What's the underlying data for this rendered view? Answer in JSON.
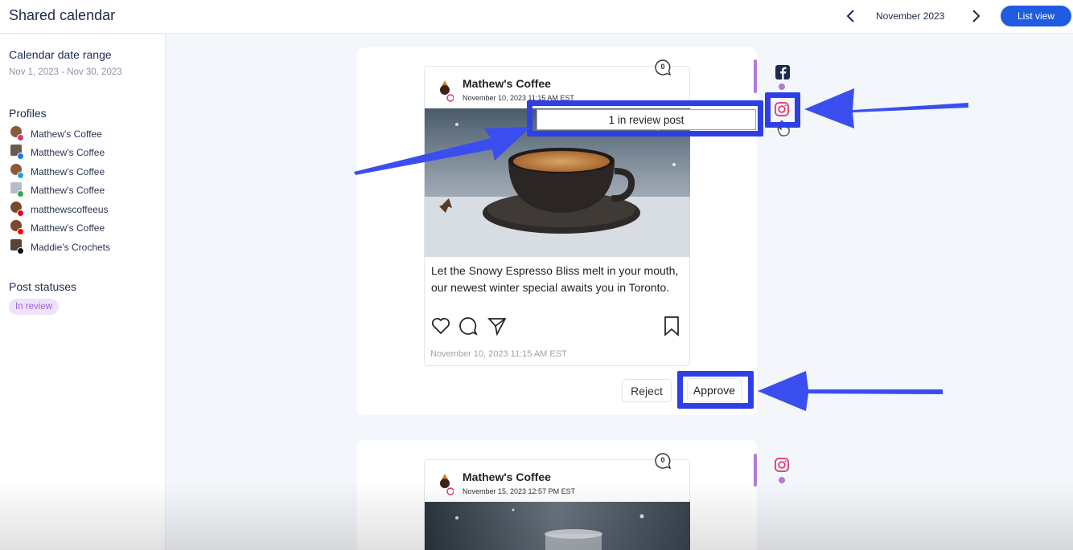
{
  "header": {
    "title": "Shared calendar",
    "month": "November 2023",
    "list_view_label": "List view"
  },
  "sidebar": {
    "date_range_heading": "Calendar date range",
    "date_range_value": "Nov 1, 2023 - Nov 30, 2023",
    "profiles_heading": "Profiles",
    "profiles": [
      {
        "name": "Mathew's Coffee",
        "network": "instagram"
      },
      {
        "name": "Matthew's Coffee",
        "network": "facebook"
      },
      {
        "name": "Matthew's Coffee",
        "network": "twitter"
      },
      {
        "name": "Matthew's Coffee",
        "network": "google"
      },
      {
        "name": "matthewscoffeeus",
        "network": "pinterest"
      },
      {
        "name": "Matthew's Coffee",
        "network": "youtube"
      },
      {
        "name": "Maddie's Crochets",
        "network": "tiktok"
      }
    ],
    "statuses_heading": "Post statuses",
    "status_label": "In review"
  },
  "posts": [
    {
      "account": "Mathew's Coffee",
      "datetime": "November 10, 2023 11:15 AM EST",
      "comment_count": "0",
      "caption": "Let the Snowy Espresso Bliss melt in your mouth, our newest winter special awaits you in Toronto.",
      "footer_date": "November 10, 2023 11:15 AM EST",
      "reject_label": "Reject",
      "approve_label": "Approve"
    },
    {
      "account": "Mathew's Coffee",
      "datetime": "November 15, 2023 12:57 PM EST",
      "comment_count": "0"
    }
  ],
  "tooltip": "1 in review post",
  "colors": {
    "primary": "#1f5ce0",
    "review_purple": "#b37ad8",
    "annotation_blue": "#2f3fe6",
    "instagram": "#e1306c"
  }
}
